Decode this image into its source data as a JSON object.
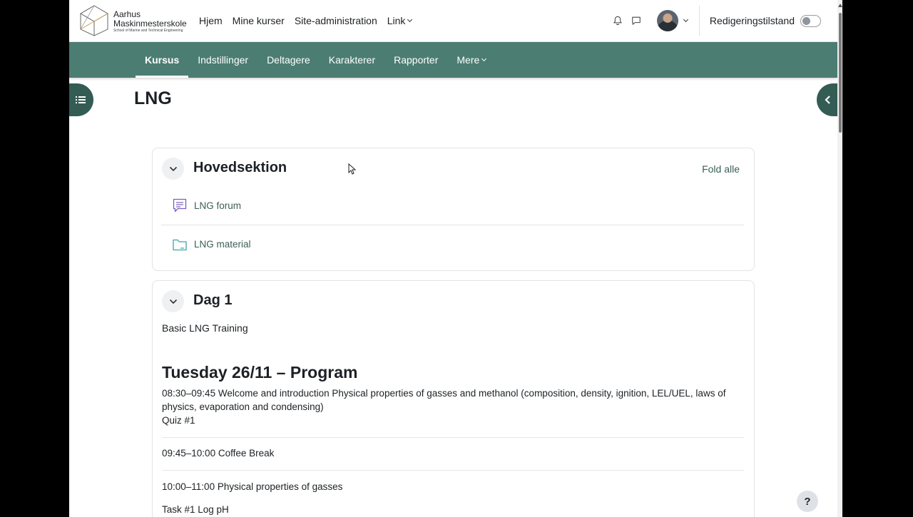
{
  "header": {
    "logo_line1": "Aarhus",
    "logo_line2": "Maskinmesterskole",
    "logo_line3": "School of Marine and Technical Engineering",
    "nav": [
      {
        "label": "Hjem"
      },
      {
        "label": "Mine kurser"
      },
      {
        "label": "Site-administration"
      },
      {
        "label": "Link"
      }
    ],
    "edit_mode_label": "Redigeringstilstand"
  },
  "secondary_nav": {
    "tabs": [
      {
        "label": "Kursus"
      },
      {
        "label": "Indstillinger"
      },
      {
        "label": "Deltagere"
      },
      {
        "label": "Karakterer"
      },
      {
        "label": "Rapporter"
      },
      {
        "label": "Mere"
      }
    ]
  },
  "page": {
    "title": "LNG"
  },
  "sections": [
    {
      "title": "Hovedsektion",
      "fold_all": "Fold alle",
      "activities": [
        {
          "label": "LNG forum",
          "icon": "forum-icon"
        },
        {
          "label": "LNG material",
          "icon": "folder-icon"
        }
      ]
    },
    {
      "title": "Dag 1",
      "summary": "Basic LNG Training",
      "program_title": "Tuesday 26/11 – Program",
      "items": [
        {
          "text": "08:30–09:45 Welcome and introduction Physical properties of gasses and methanol (composition, density, ignition, LEL/UEL, laws of physics, evaporation and condensing)",
          "sub": "Quiz #1"
        },
        {
          "text": "09:45–10:00 Coffee Break"
        },
        {
          "text": "10:00–11:00 Physical properties of gasses",
          "sub": "Task #1 Log pH"
        }
      ]
    }
  ],
  "colors": {
    "brand": "#4c7d72",
    "drawer": "#335c54",
    "link": "#3b5f57"
  },
  "help_label": "?"
}
